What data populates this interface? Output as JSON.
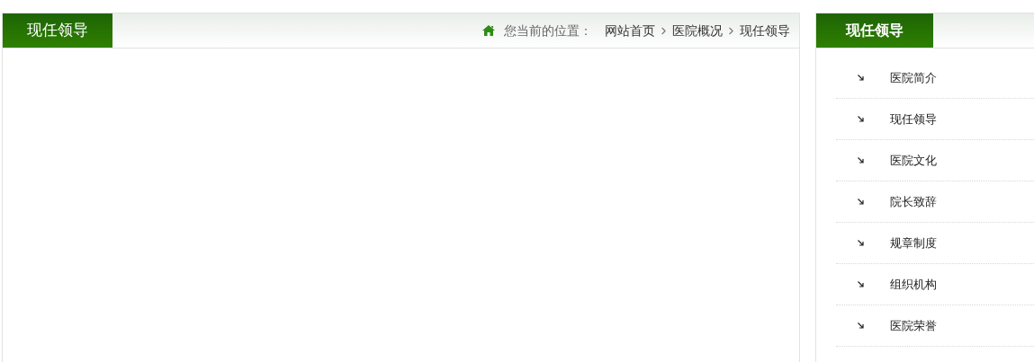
{
  "main": {
    "title": "现任领导",
    "breadcrumb": {
      "label": "您当前的位置：",
      "links": [
        "网站首页",
        "医院概况",
        "现任领导"
      ]
    }
  },
  "sidebar": {
    "title": "现任领导",
    "items": [
      "医院简介",
      "现任领导",
      "医院文化",
      "院长致辞",
      "规章制度",
      "组织机构",
      "医院荣誉"
    ]
  }
}
